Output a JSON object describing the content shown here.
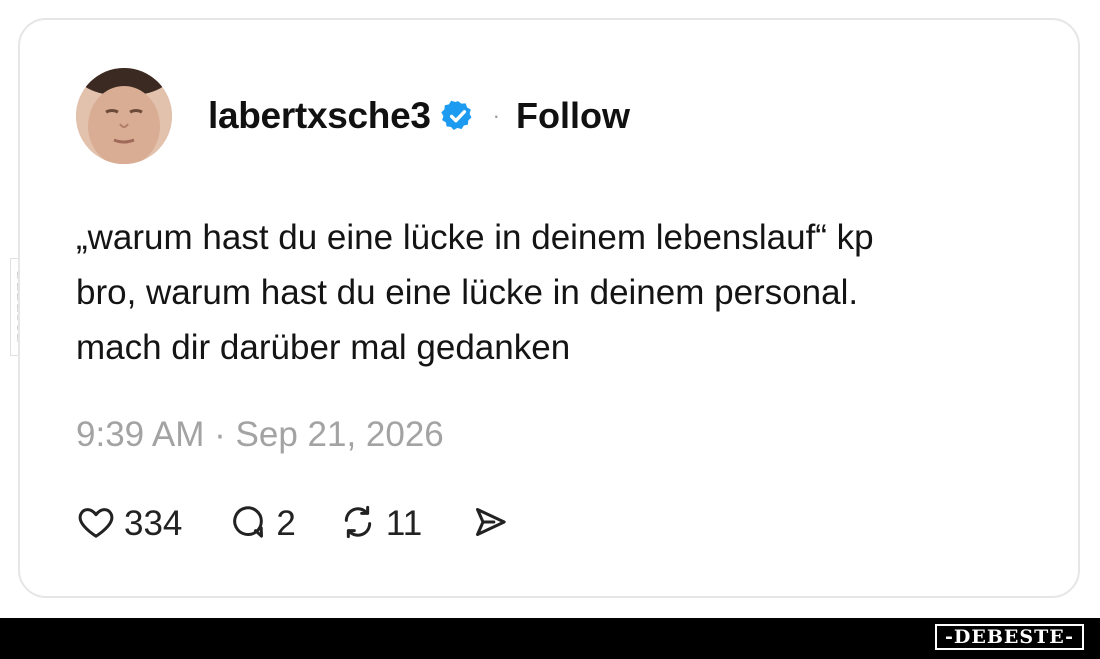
{
  "post": {
    "username": "labertxsche3",
    "separator": "·",
    "follow_label": "Follow",
    "text_lines": [
      "„warum hast du eine lücke in deinem lebenslauf“ kp",
      "bro, warum hast du eine lücke in deinem personal.",
      "mach dir darüber mal gedanken"
    ],
    "timestamp": "9:39 AM · Sep 21, 2026",
    "likes": "334",
    "replies": "2",
    "reposts": "11"
  },
  "watermark": {
    "side": "DEBESTE",
    "bottom": "-DEBESTE-"
  },
  "icons": [
    "avatar",
    "verified-badge-icon",
    "heart-icon",
    "reply-icon",
    "repost-icon",
    "share-icon"
  ],
  "colors": {
    "verified": "#1d9bf0",
    "timestamp": "#a3a3a3",
    "text": "#141414",
    "bottom_bar": "#000000"
  }
}
